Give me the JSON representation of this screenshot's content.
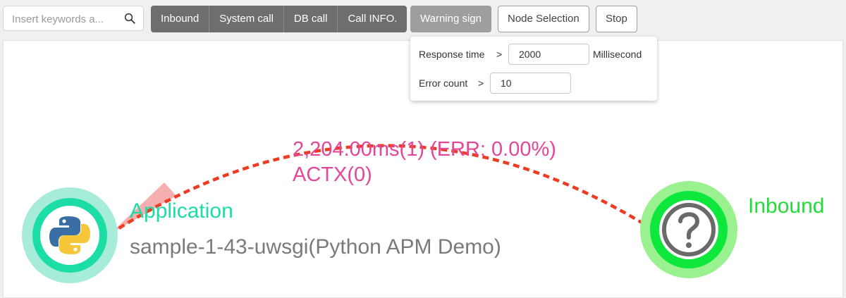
{
  "toolbar": {
    "search_placeholder": "Insert keywords a...",
    "filter_group": [
      "Inbound",
      "System call",
      "DB call",
      "Call INFO."
    ],
    "warning_label": "Warning sign",
    "node_selection_label": "Node Selection",
    "stop_label": "Stop"
  },
  "warning_popup": {
    "response_time_label": "Response time",
    "response_time_op": ">",
    "response_time_value": "2000",
    "response_time_unit": "Millisecond",
    "error_count_label": "Error count",
    "error_count_op": ">",
    "error_count_value": "10"
  },
  "topology": {
    "source_node": {
      "type_label": "Application",
      "name": "sample-1-43-uwsgi(Python APM Demo)",
      "icon": "python-icon",
      "ring_color": "#a6ecd8",
      "inner_ring_color": "#1ddda7",
      "label_color": "#1ddda7"
    },
    "target_node": {
      "type_label": "Inbound",
      "icon": "question-mark-icon",
      "ring_color": "#9af18f",
      "inner_ring_color": "#0ee83d",
      "label_color": "#23dc3a"
    },
    "edge": {
      "response_label": "2,204.00ms(1) (ERR: 0.00%)",
      "actx_label": "ACTX(0)",
      "color": "#ee3b23",
      "label_color": "#e2479a"
    }
  }
}
